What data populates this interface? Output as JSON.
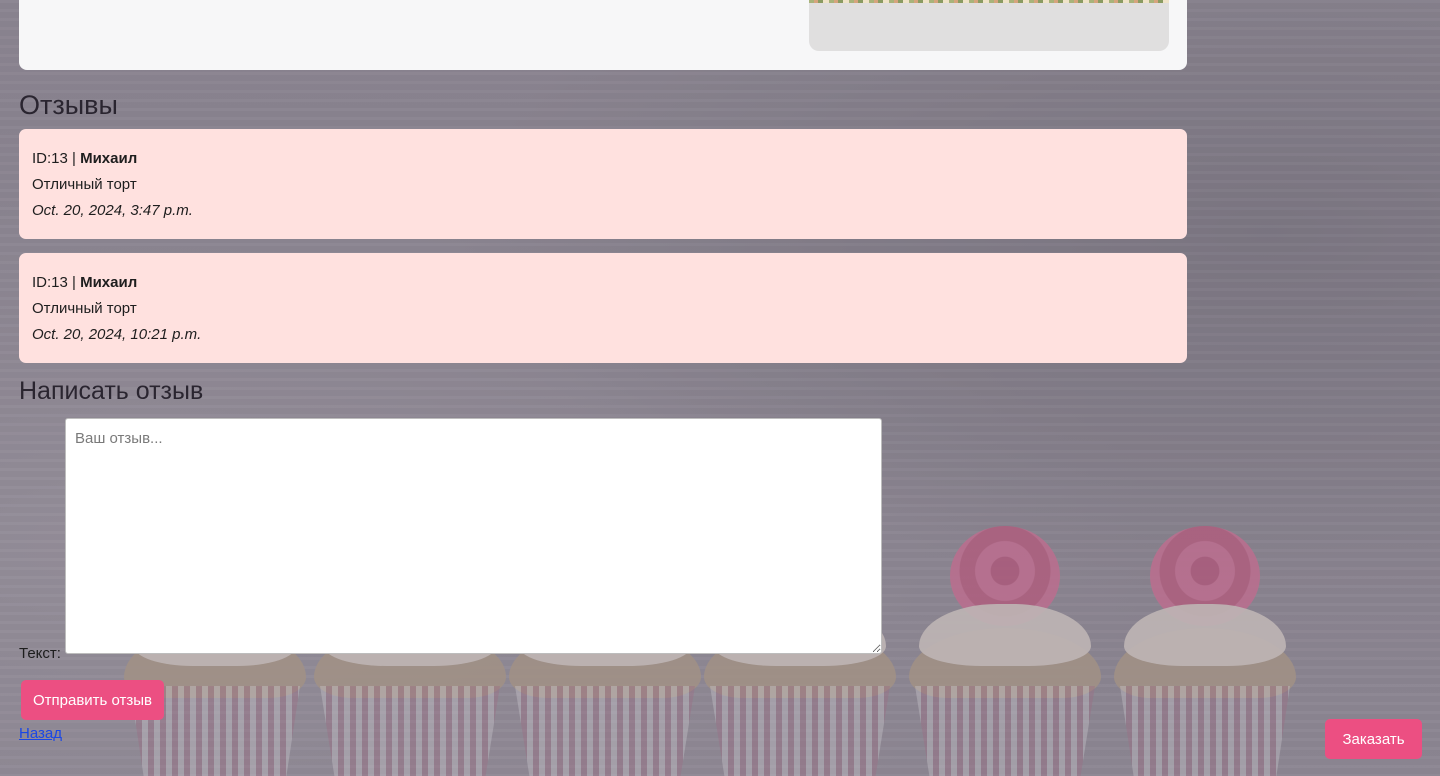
{
  "reviews_section": {
    "title": "Отзывы",
    "items": [
      {
        "id_label": "ID:13 |",
        "author": "Михаил",
        "text": "Отличный торт",
        "date": "Oct. 20, 2024, 3:47 p.m."
      },
      {
        "id_label": "ID:13 |",
        "author": "Михаил",
        "text": "Отличный торт",
        "date": "Oct. 20, 2024, 10:21 p.m."
      }
    ]
  },
  "review_form": {
    "title": "Написать отзыв",
    "text_label": "Текст:",
    "placeholder": "Ваш отзыв...",
    "submit_label": "Отправить отзыв"
  },
  "navigation": {
    "back_label": "Назад",
    "order_label": "Заказать"
  },
  "colors": {
    "accent": "#ec4f82",
    "review_bg": "#ffe1df",
    "link": "#1a47e6"
  }
}
